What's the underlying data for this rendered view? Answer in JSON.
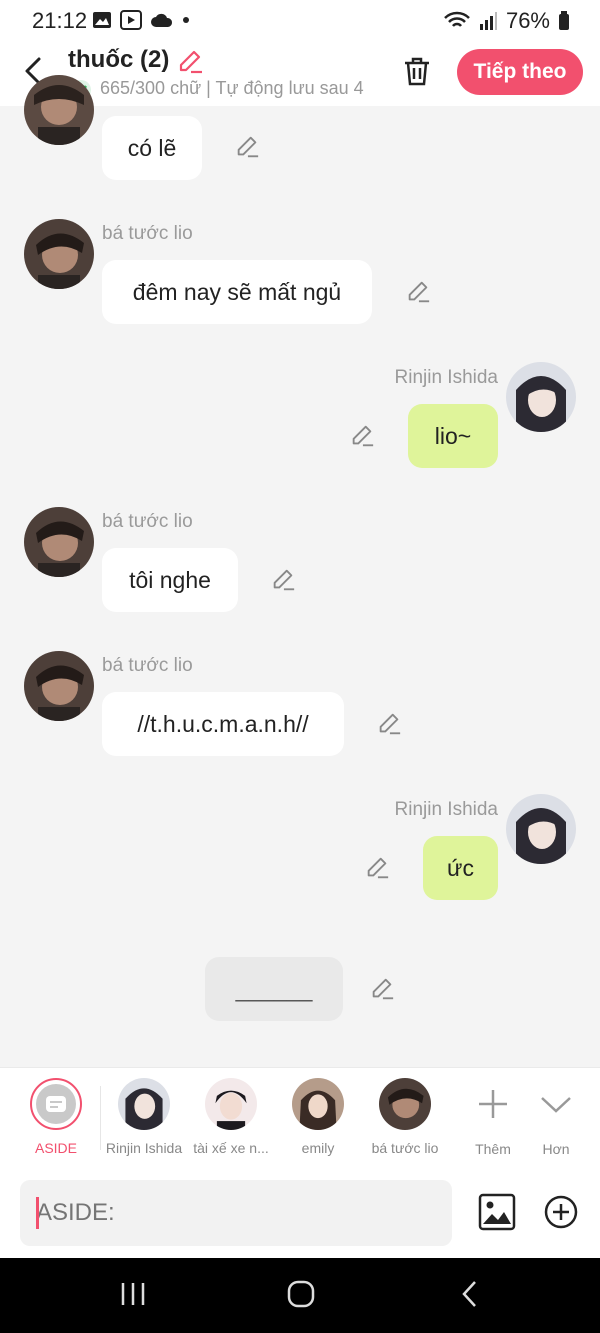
{
  "status": {
    "time": "21:12",
    "battery": "76%"
  },
  "header": {
    "title": "thuốc (2)",
    "subtitle": "665/300 chữ | Tự động lưu sau 4",
    "next_label": "Tiếp theo"
  },
  "messages": [
    {
      "speaker": "",
      "text": "có lẽ"
    },
    {
      "speaker": "bá tước lio",
      "text": "đêm nay sẽ mất ngủ"
    },
    {
      "speaker": "Rinjin Ishida",
      "text": "lio~"
    },
    {
      "speaker": "bá tước lio",
      "text": "tôi nghe"
    },
    {
      "speaker": "bá tước lio",
      "text": "//t.h.u.c.m.a.n.h//"
    },
    {
      "speaker": "Rinjin Ishida",
      "text": "ức"
    },
    {
      "speaker": "",
      "text": "______"
    }
  ],
  "roster": {
    "items": [
      {
        "label": "ASIDE"
      },
      {
        "label": "Rinjin Ishida"
      },
      {
        "label": "tài xế xe n..."
      },
      {
        "label": "emily"
      },
      {
        "label": "bá tước lio"
      },
      {
        "label": "Thêm"
      },
      {
        "label": "Hơn"
      }
    ]
  },
  "input": {
    "placeholder": "ASIDE:"
  },
  "colors": {
    "accent": "#f2506e",
    "my_bubble": "#dff49a",
    "background": "#f4f4f4"
  }
}
